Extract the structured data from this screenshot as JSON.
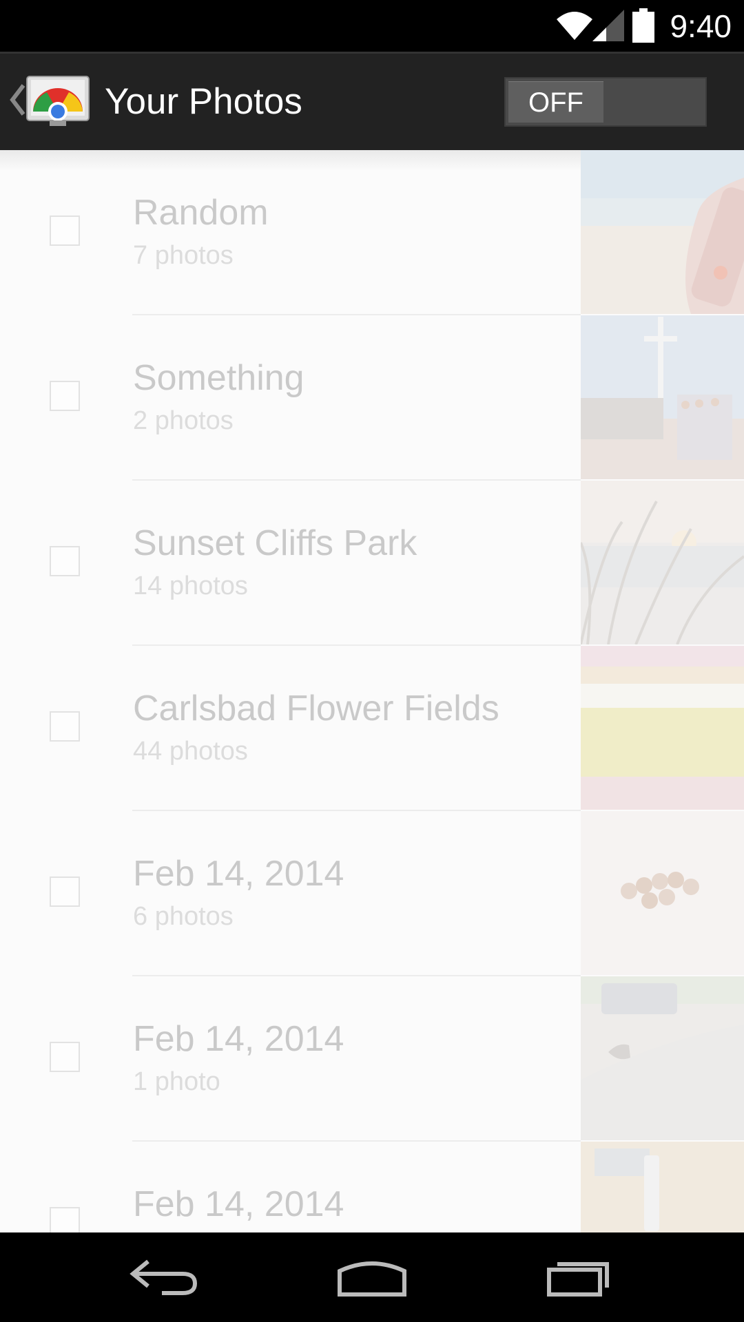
{
  "status_bar": {
    "time": "9:40",
    "icons": [
      "wifi-icon",
      "signal-icon",
      "battery-icon"
    ]
  },
  "action_bar": {
    "title": "Your Photos",
    "toggle_label": "OFF",
    "icons": [
      "back-caret-icon",
      "chromecast-app-icon"
    ]
  },
  "albums": [
    {
      "title": "Random",
      "count": "7 photos"
    },
    {
      "title": "Something",
      "count": "2 photos"
    },
    {
      "title": "Sunset Cliffs Park",
      "count": "14 photos"
    },
    {
      "title": "Carlsbad Flower Fields",
      "count": "44 photos"
    },
    {
      "title": "Feb 14, 2014",
      "count": "6 photos"
    },
    {
      "title": "Feb 14, 2014",
      "count": "1 photo"
    },
    {
      "title": "Feb 14, 2014",
      "count": ""
    }
  ],
  "nav_bar": {
    "icons": [
      "back-icon",
      "home-icon",
      "recent-apps-icon"
    ]
  },
  "colors": {
    "status_bar": "#000000",
    "action_bar": "#222222",
    "list_bg": "#fbfbfb",
    "text_faded": "#c9c9c9"
  }
}
